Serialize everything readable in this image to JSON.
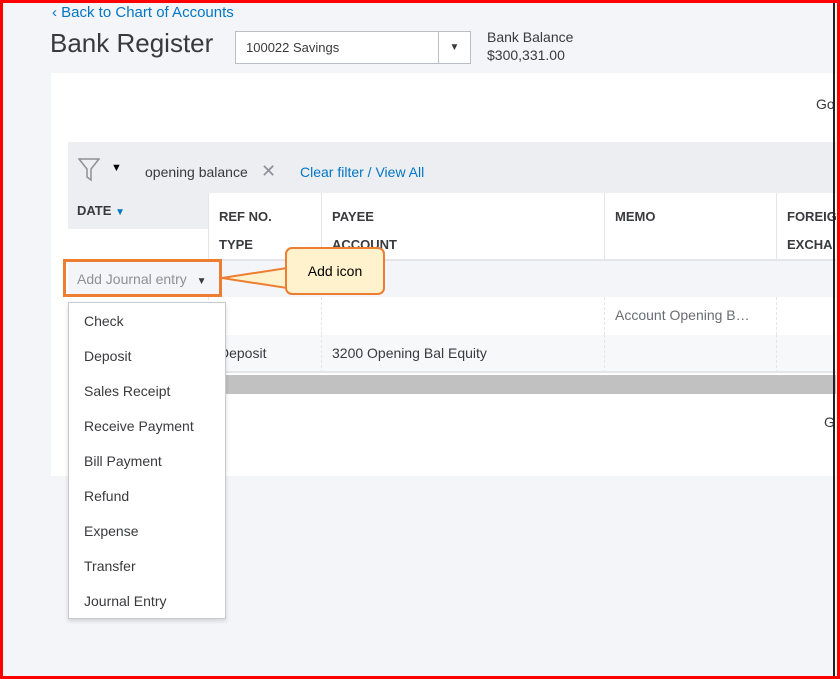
{
  "header": {
    "back_link": "Back to Chart of Accounts",
    "title": "Bank Register",
    "account_select": "100022 Savings",
    "balance_label": "Bank Balance",
    "balance_value": "$300,331.00",
    "go_top": "Go",
    "go_bottom": "G"
  },
  "filter": {
    "chip": "opening balance",
    "clear": "Clear filter / View All"
  },
  "columns": {
    "date": "DATE",
    "ref": "REF NO.",
    "type": "TYPE",
    "payee": "PAYEE",
    "account": "ACCOUNT",
    "memo": "MEMO",
    "foreign": "FOREIG",
    "exchange": "EXCHA"
  },
  "add_button": "Add Journal entry",
  "callout": "Add icon",
  "rows": [
    {
      "memo": "Account Opening B…"
    },
    {
      "type": "Deposit",
      "account": "3200 Opening Bal Equity"
    }
  ],
  "menu": [
    "Check",
    "Deposit",
    "Sales Receipt",
    "Receive Payment",
    "Bill Payment",
    "Refund",
    "Expense",
    "Transfer",
    "Journal Entry"
  ],
  "colors": {
    "link": "#0077c5",
    "highlight": "#ed7d31",
    "callout_fill": "#fff2cc",
    "frame": "#ff0000"
  }
}
